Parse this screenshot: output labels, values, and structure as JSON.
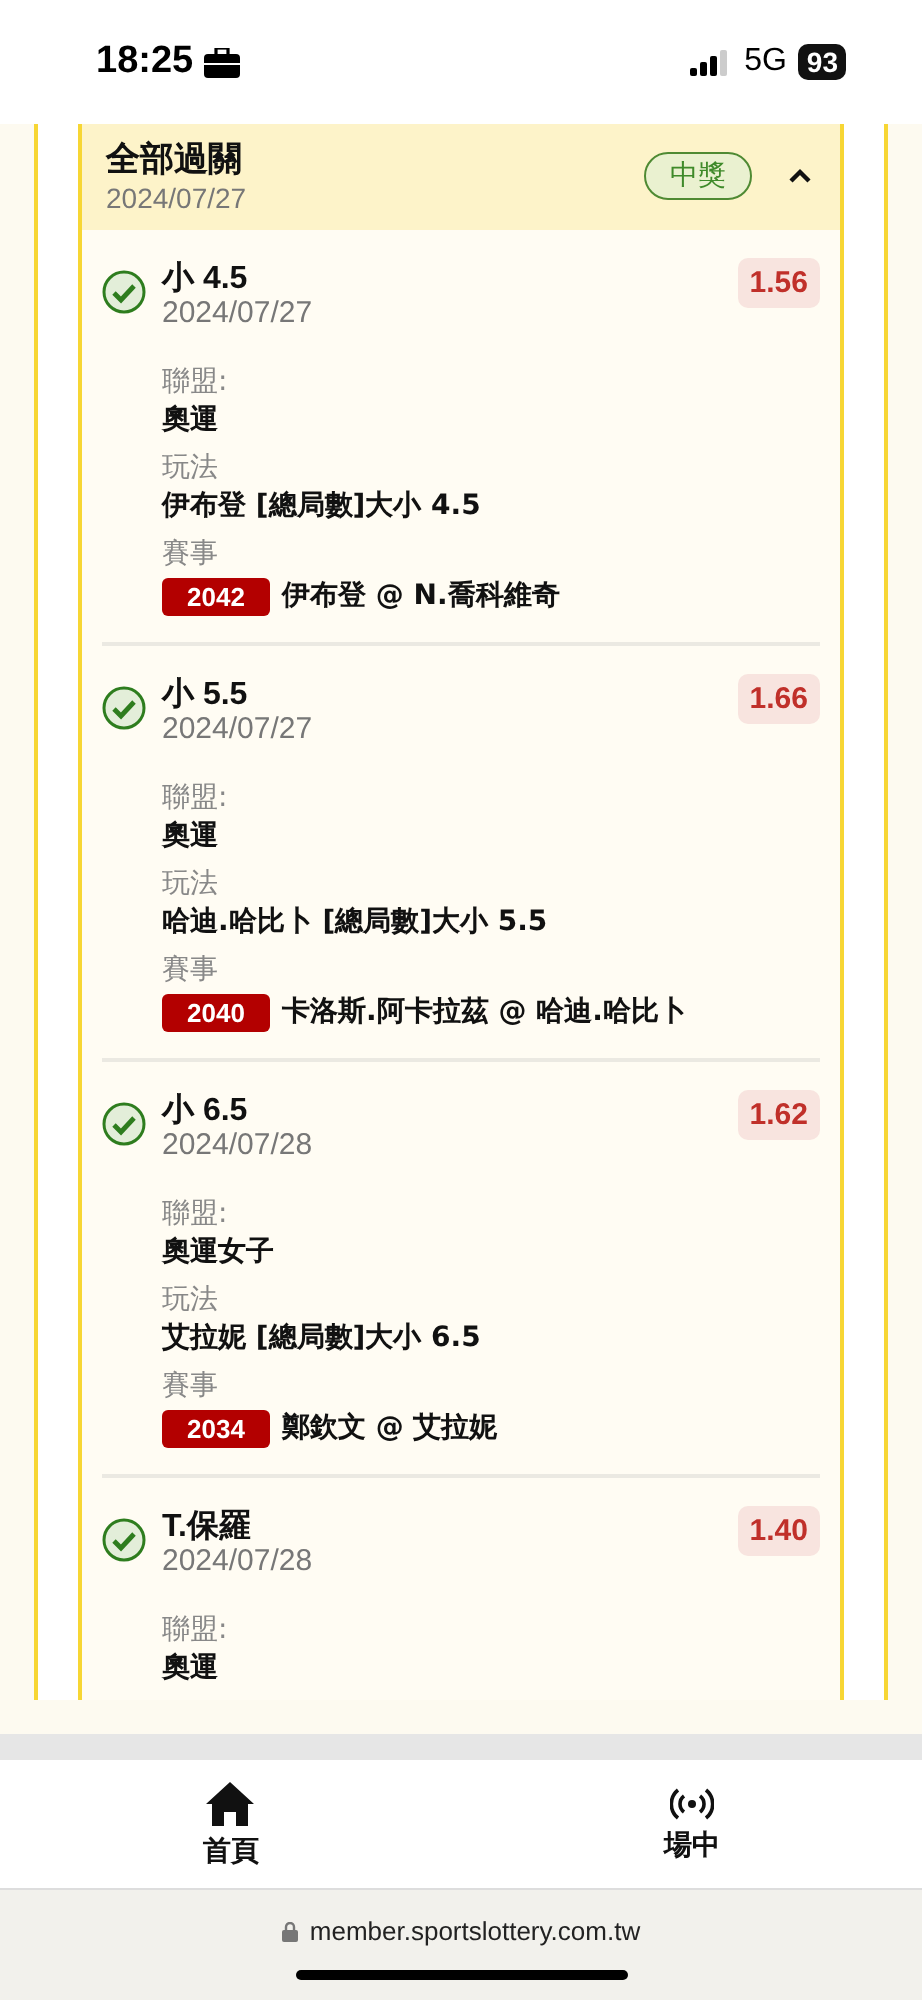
{
  "status_bar": {
    "time": "18:25",
    "network": "5G",
    "battery": "93"
  },
  "parlay": {
    "title": "全部過關",
    "date": "2024/07/27",
    "result": "中獎",
    "expanded": true,
    "bets": [
      {
        "pick": "小 4.5",
        "date": "2024/07/27",
        "odds": "1.56",
        "won": true,
        "fields": [
          {
            "kind": "text",
            "label": "聯盟:",
            "value": "奧運"
          },
          {
            "kind": "text",
            "label": "玩法",
            "value": "伊布登 [總局數]大小 4.5"
          },
          {
            "kind": "event",
            "label": "賽事",
            "code": "2042",
            "value": "伊布登 @ N.喬科維奇"
          }
        ]
      },
      {
        "pick": "小 5.5",
        "date": "2024/07/27",
        "odds": "1.66",
        "won": true,
        "fields": [
          {
            "kind": "text",
            "label": "聯盟:",
            "value": "奧運"
          },
          {
            "kind": "text",
            "label": "玩法",
            "value": "哈迪.哈比卜 [總局數]大小 5.5"
          },
          {
            "kind": "event",
            "label": "賽事",
            "code": "2040",
            "value": "卡洛斯.阿卡拉茲 @ 哈迪.哈比卜"
          }
        ]
      },
      {
        "pick": "小 6.5",
        "date": "2024/07/28",
        "odds": "1.62",
        "won": true,
        "fields": [
          {
            "kind": "text",
            "label": "聯盟:",
            "value": "奧運女子"
          },
          {
            "kind": "text",
            "label": "玩法",
            "value": "艾拉妮 [總局數]大小 6.5"
          },
          {
            "kind": "event",
            "label": "賽事",
            "code": "2034",
            "value": "鄭欽文 @ 艾拉妮"
          }
        ]
      },
      {
        "pick": "T.保羅",
        "date": "2024/07/28",
        "odds": "1.40",
        "won": true,
        "fields": [
          {
            "kind": "text",
            "label": "聯盟:",
            "value": "奧運"
          }
        ]
      }
    ]
  },
  "tab_bar": [
    {
      "kind": "home",
      "label": "首頁"
    },
    {
      "kind": "live",
      "label": "場中"
    }
  ],
  "url_bar": {
    "url": "member.sportslottery.com.tw"
  }
}
